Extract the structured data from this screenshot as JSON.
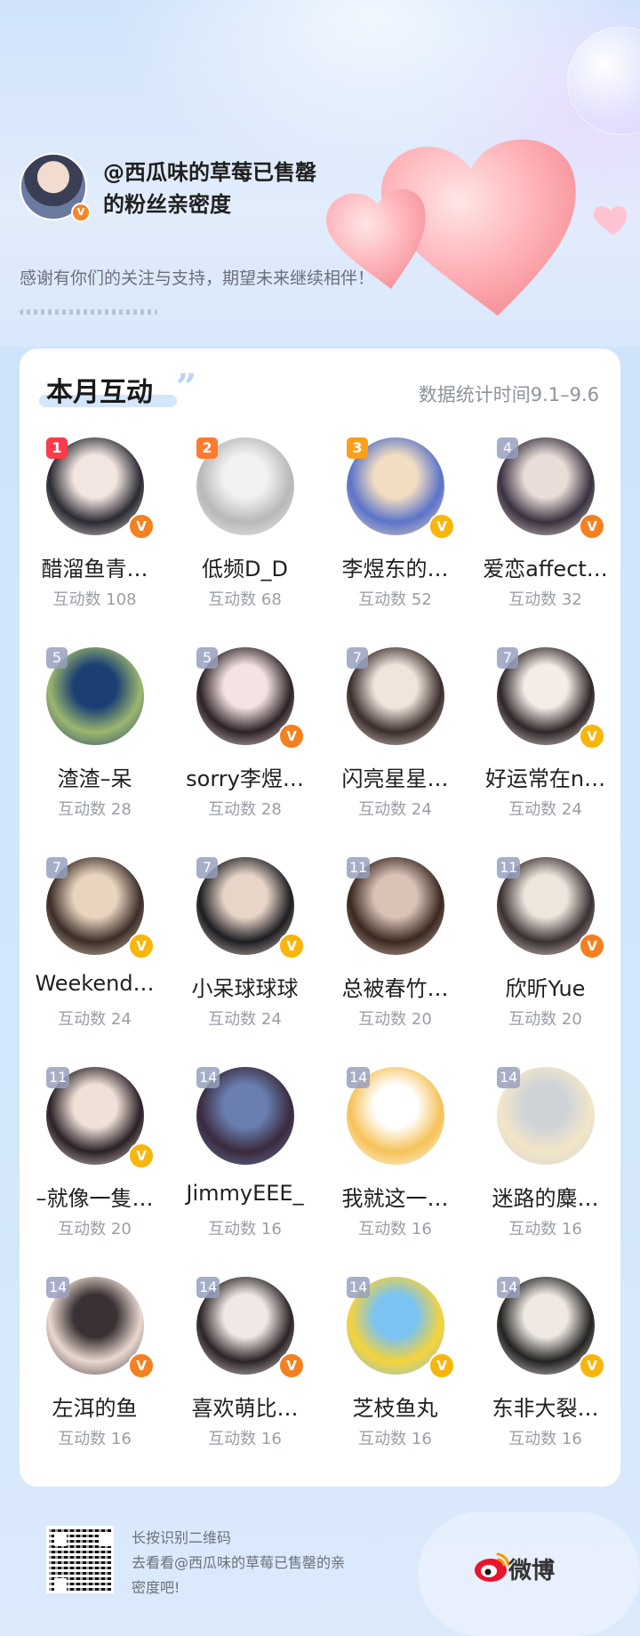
{
  "header": {
    "title_line1": "@西瓜味的草莓已售罄",
    "title_line2": "的粉丝亲密度",
    "thanks": "感谢有你们的关注与支持，期望未来继续相伴！",
    "owner_avatar_icon": "user-avatar",
    "owner_badge": "V"
  },
  "card": {
    "title": "本月互动",
    "quote_mark": "”",
    "period": "数据统计时间9.1–9.6"
  },
  "fans": [
    {
      "rank": "1",
      "name": "醋溜鱼青…",
      "count": "互动数 108",
      "badge": "orange",
      "c1": "#f3e6e1",
      "c2": "#2a2a33"
    },
    {
      "rank": "2",
      "name": "低频D_D",
      "count": "互动数 68",
      "badge": "none",
      "c1": "#f2f2f2",
      "c2": "#b8b8b8"
    },
    {
      "rank": "3",
      "name": "李煜东的…",
      "count": "互动数 52",
      "badge": "gold",
      "c1": "#f2ddc1",
      "c2": "#5b73c9"
    },
    {
      "rank": "4",
      "name": "爱恋affect…",
      "count": "互动数 32",
      "badge": "orange",
      "c1": "#e9ddd8",
      "c2": "#3a3140"
    },
    {
      "rank": "5",
      "name": "渣渣–呆",
      "count": "互动数 28",
      "badge": "none",
      "c1": "#1b3f73",
      "c2": "#9bb76e"
    },
    {
      "rank": "5",
      "name": "sorry李煜…",
      "count": "互动数 28",
      "badge": "orange",
      "c1": "#f4e3e2",
      "c2": "#2d2227"
    },
    {
      "rank": "7",
      "name": "闪亮星星…",
      "count": "互动数 24",
      "badge": "none",
      "c1": "#f0e4dc",
      "c2": "#3b2d2a"
    },
    {
      "rank": "7",
      "name": "好运常在n…",
      "count": "互动数 24",
      "badge": "gold",
      "c1": "#f5ece6",
      "c2": "#2e2628"
    },
    {
      "rank": "7",
      "name": "Weekend…",
      "count": "互动数 24",
      "badge": "gold",
      "c1": "#e9d4bf",
      "c2": "#3a2d27"
    },
    {
      "rank": "7",
      "name": "小呆球球球",
      "count": "互动数 24",
      "badge": "gold",
      "c1": "#e8d5c8",
      "c2": "#1d1d22"
    },
    {
      "rank": "11",
      "name": "总被春竹…",
      "count": "互动数 20",
      "badge": "none",
      "c1": "#d9c2b6",
      "c2": "#3a2820"
    },
    {
      "rank": "11",
      "name": "欣昕Yue",
      "count": "互动数 20",
      "badge": "orange",
      "c1": "#eee5dc",
      "c2": "#3a3032"
    },
    {
      "rank": "11",
      "name": "–就像一隻…",
      "count": "互动数 20",
      "badge": "gold",
      "c1": "#f0e1d8",
      "c2": "#2a2026"
    },
    {
      "rank": "14",
      "name": "JimmyEEE_",
      "count": "互动数 16",
      "badge": "none",
      "c1": "#6a7fb0",
      "c2": "#3a2a3d"
    },
    {
      "rank": "14",
      "name": "我就这一…",
      "count": "互动数 16",
      "badge": "none",
      "c1": "#ffffff",
      "c2": "#f5c258"
    },
    {
      "rank": "14",
      "name": "迷路的麋…",
      "count": "互动数 16",
      "badge": "none",
      "c1": "#cfd3d8",
      "c2": "#f3e6c8"
    },
    {
      "rank": "14",
      "name": "左洱的鱼",
      "count": "互动数 16",
      "badge": "orange",
      "c1": "#3a3134",
      "c2": "#e9d8cf"
    },
    {
      "rank": "14",
      "name": "喜欢萌比…",
      "count": "互动数 16",
      "badge": "orange",
      "c1": "#efe8e4",
      "c2": "#2b2326"
    },
    {
      "rank": "14",
      "name": "芝枝鱼丸",
      "count": "互动数 16",
      "badge": "gold",
      "c1": "#7ac3f2",
      "c2": "#f5d33a"
    },
    {
      "rank": "14",
      "name": "东非大裂…",
      "count": "互动数 16",
      "badge": "gold",
      "c1": "#f0e9e2",
      "c2": "#232323"
    }
  ],
  "footer": {
    "line1": "长按识别二维码",
    "line2": "去看看@西瓜味的草莓已售罄的亲",
    "line3": "密度吧!",
    "brand": "微博",
    "qr_icon": "qr-code-icon",
    "logo_icon": "weibo-logo-icon"
  }
}
